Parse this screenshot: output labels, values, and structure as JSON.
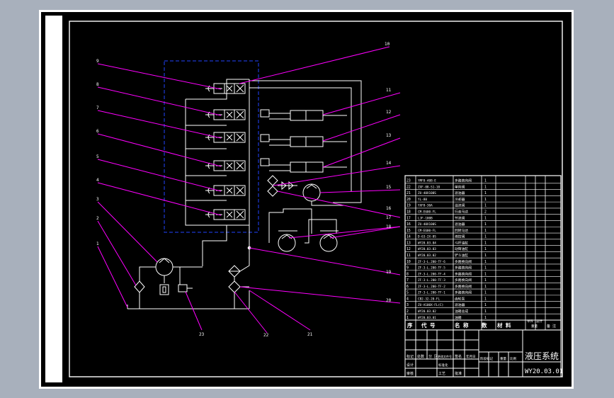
{
  "colors": {
    "viewport": "#a8b0bc",
    "sheet": "#ffffff",
    "canvas": "#000000",
    "line": "#ffffff",
    "leader": "#ff00ff",
    "dashed_box": "#2244ff"
  },
  "callouts": {
    "left": [
      "9",
      "8",
      "7",
      "6",
      "5",
      "4",
      "3",
      "2",
      "1"
    ],
    "right": [
      "10",
      "11",
      "12",
      "13",
      "14",
      "15",
      "16",
      "17",
      "18",
      "19",
      "20"
    ],
    "bottom": [
      "23",
      "22",
      "21"
    ]
  },
  "parts_list": {
    "rows": [
      {
        "no": "23",
        "code": "YMF8-40B-E",
        "name": "多路换向阀",
        "qty": "1"
      },
      {
        "no": "22",
        "code": "ZXF-08-S1-10",
        "name": "单向阀",
        "qty": "1"
      },
      {
        "no": "21",
        "code": "ZU-40X100S",
        "name": "滤油器",
        "qty": "1"
      },
      {
        "no": "20",
        "code": "YL-80",
        "name": "冷却器",
        "qty": "1"
      },
      {
        "no": "19",
        "code": "YXF8-30A",
        "name": "溢流阀",
        "qty": "1"
      },
      {
        "no": "18",
        "code": "CM-E600-FL",
        "name": "行走马达",
        "qty": "2"
      },
      {
        "no": "17",
        "code": "LJF-100B",
        "name": "节流阀",
        "qty": "1"
      },
      {
        "no": "16",
        "code": "ZU-40X100S",
        "name": "滤油器",
        "qty": "1"
      },
      {
        "no": "15",
        "code": "CM-E600-FL",
        "name": "回转马达",
        "qty": "1"
      },
      {
        "no": "14",
        "code": "D-63-2X-0S",
        "name": "液控阀",
        "qty": "1"
      },
      {
        "no": "13",
        "code": "WY20.03.04",
        "name": "斗杆油缸",
        "qty": "1"
      },
      {
        "no": "12",
        "code": "WY20.03.03",
        "name": "动臂油缸",
        "qty": "1"
      },
      {
        "no": "11",
        "code": "WY20.03.02",
        "name": "铲斗油缸",
        "qty": "1"
      },
      {
        "no": "10",
        "code": "ZF-3-L.200-TF-6",
        "name": "多路换向阀",
        "qty": "1"
      },
      {
        "no": "9",
        "code": "ZF-3-L.200-TF-5",
        "name": "多路换向阀",
        "qty": "1"
      },
      {
        "no": "8",
        "code": "ZF-3-L.200-TF-4",
        "name": "多路换向阀",
        "qty": "1"
      },
      {
        "no": "7",
        "code": "ZF-3-L.200-TF-3",
        "name": "多路换向阀",
        "qty": "1"
      },
      {
        "no": "6",
        "code": "ZF-3-L.200-TF-2",
        "name": "多路换向阀",
        "qty": "1"
      },
      {
        "no": "5",
        "code": "ZF-3-L.200-TF-1",
        "name": "多路换向阀",
        "qty": "1"
      },
      {
        "no": "4",
        "code": "CB2-32-20-FL",
        "name": "齿轮泵",
        "qty": "1"
      },
      {
        "no": "3",
        "code": "ZU-A100X-FL(C)",
        "name": "滤油器",
        "qty": "1"
      },
      {
        "no": "2",
        "code": "WY20.03.02",
        "name": "油箱总成",
        "qty": "1"
      },
      {
        "no": "1",
        "code": "WY20.03.01",
        "name": "油箱",
        "qty": "1"
      }
    ],
    "header": {
      "no": "序",
      "code": "代 号",
      "name": "名 称",
      "qty": "数",
      "material": "材 料",
      "unit": "单件",
      "total": "总计",
      "note": "备 注",
      "weight": "重量"
    }
  },
  "title_block": {
    "title": "液压系统",
    "drawing_no": "WY20.03.01",
    "labels": {
      "mark": "标记",
      "count": "处数",
      "zone": "分 区",
      "change_doc": "更改文件号",
      "signature": "签名",
      "date": "年月日",
      "design": "设计",
      "standard": "标准化",
      "review": "审核",
      "process": "工艺",
      "approve": "批准",
      "stage_mark": "阶段标记",
      "weight": "重量",
      "scale": "比例"
    }
  }
}
